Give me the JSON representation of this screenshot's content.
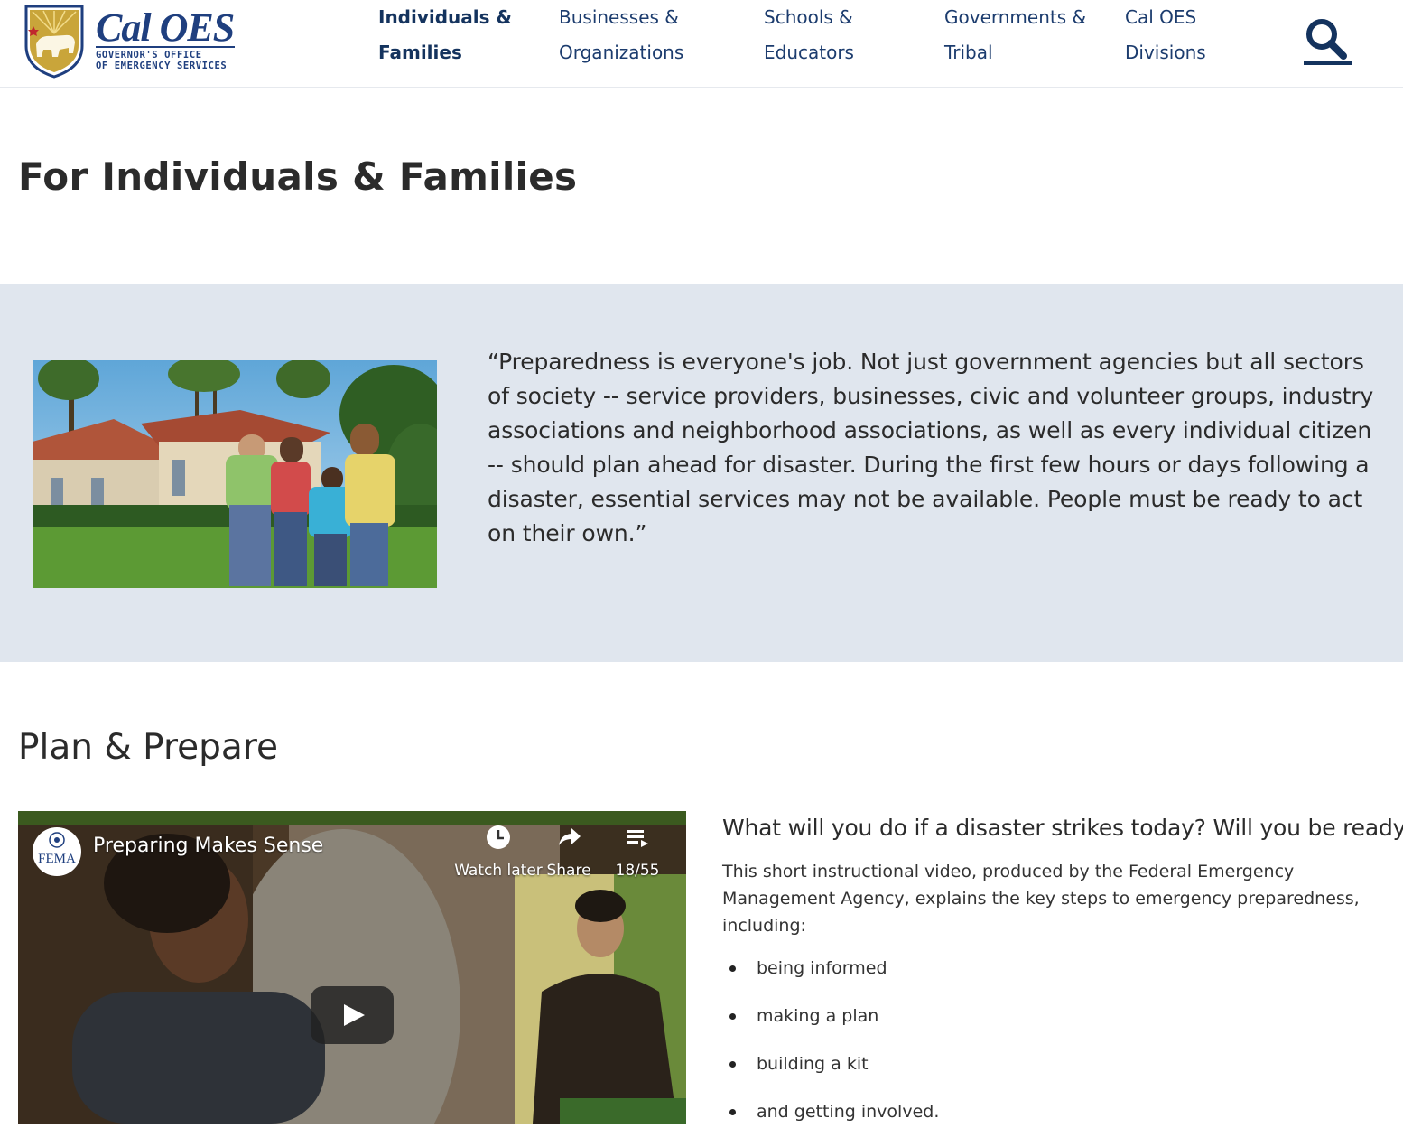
{
  "header": {
    "logo": {
      "name": "Cal OES",
      "subtitle_line1": "GOVERNOR'S OFFICE",
      "subtitle_line2": "OF EMERGENCY SERVICES"
    },
    "nav": [
      {
        "line1": "Individuals &",
        "line2": "Families",
        "active": true
      },
      {
        "line1": "Businesses &",
        "line2": "Organizations",
        "active": false
      },
      {
        "line1": "Schools &",
        "line2": "Educators",
        "active": false
      },
      {
        "line1": "Governments &",
        "line2": "Tribal",
        "active": false
      },
      {
        "line1": "Cal OES",
        "line2": "Divisions",
        "active": false
      }
    ],
    "search_icon": "search-icon"
  },
  "page": {
    "title": "For Individuals & Families",
    "quote": "“Preparedness is everyone's job. Not just government agencies but all sectors of society -- service providers, businesses, civic and volunteer groups, industry associations and neighborhood associations, as well as every individual citizen -- should plan ahead for disaster. During the first few hours or days following a disaster, essential services may not be available. People must be ready to act on their own.”"
  },
  "plan": {
    "title": "Plan & Prepare",
    "video": {
      "channel_badge": "FEMA",
      "title": "Preparing Makes Sense",
      "watch_later": "Watch later",
      "share": "Share",
      "playlist_position": "18/55",
      "icons": [
        "clock-icon",
        "share-arrow-icon",
        "playlist-icon",
        "play-icon"
      ]
    },
    "heading": "What will you do if a disaster strikes today? Will you be ready?",
    "description": "This short instructional video, produced by the Federal Emergency Management Agency, explains  the key steps to emergency preparedness, including:",
    "steps": [
      "being informed",
      "making a plan",
      "building a kit",
      "and getting involved."
    ]
  },
  "colors": {
    "brand_blue": "#1f3f7f",
    "nav_text": "#1c3c6e",
    "band_bg": "#e0e6ee",
    "logo_gold": "#c9a53a"
  }
}
